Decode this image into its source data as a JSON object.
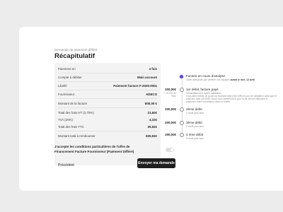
{
  "header": {
    "eyebrow": "Demande de paiement différé",
    "title": "Récapitulatif"
  },
  "summary": {
    "rows": [
      {
        "label": "Paiement en",
        "value": "4 fois"
      },
      {
        "label": "Compte à débiter",
        "value": "Main account"
      },
      {
        "label": "Libellé",
        "value": "Paiement facture F-2025-0001"
      },
      {
        "label": "Fournisseur",
        "value": "ADECO"
      },
      {
        "label": "Montant de la facture",
        "value": "800,00 €"
      },
      {
        "label": "Total des frais HT (2,70%)",
        "value": "21,60€"
      },
      {
        "label": "TVA (20%)",
        "value": "4,32€"
      },
      {
        "label": "Total des frais TTC",
        "value": "25,92€"
      },
      {
        "label": "Montant total à rembourser",
        "value": "825,92€"
      }
    ]
  },
  "consent": {
    "text": "J'accepte les conditions particulières de l'offre de Financement Facture Fournisseur (Paiement Différé)",
    "checked": false
  },
  "actions": {
    "previous_label": "Précédent",
    "submit_label": "Envoyer ma demande"
  },
  "timeline": {
    "accent_color": "#5b3fe0",
    "steps": [
      {
        "amount": "",
        "amount_sub": "",
        "title": "Facture en cours d'analyse",
        "subtitle_prefix": "Votre demande par vérifiée nos équipes",
        "subtitle_bold": "avant le mer. 12 avril",
        "description": "",
        "active": true
      },
      {
        "amount": "200,00€",
        "amount_sub": "+ 25,92€ de frais",
        "title": "1er débit, facture payé",
        "subtitle_prefix": "Immédiatement après validation",
        "subtitle_bold": "",
        "description": "Vous allez débité un quart du montant total (200,00€) le jour de validation ainsi que le total des frais (25,92€). Nous vous avertirons le jour ou ils seront effectués et payerons votre fournisseur dans la foulée.",
        "active": false
      },
      {
        "amount": "200,00€",
        "amount_sub": "",
        "title": "2ème débit",
        "subtitle_prefix": "1 mois plus tard",
        "subtitle_bold": "",
        "description": "",
        "active": false
      },
      {
        "amount": "200,00€",
        "amount_sub": "",
        "title": "3ème débit",
        "subtitle_prefix": "2 mois plus tard",
        "subtitle_bold": "",
        "description": "",
        "active": false
      },
      {
        "amount": "200,00€",
        "amount_sub": "",
        "title": "4 ème débit",
        "subtitle_prefix": "3 mois plus tard",
        "subtitle_bold": "",
        "description": "",
        "active": false
      }
    ]
  }
}
